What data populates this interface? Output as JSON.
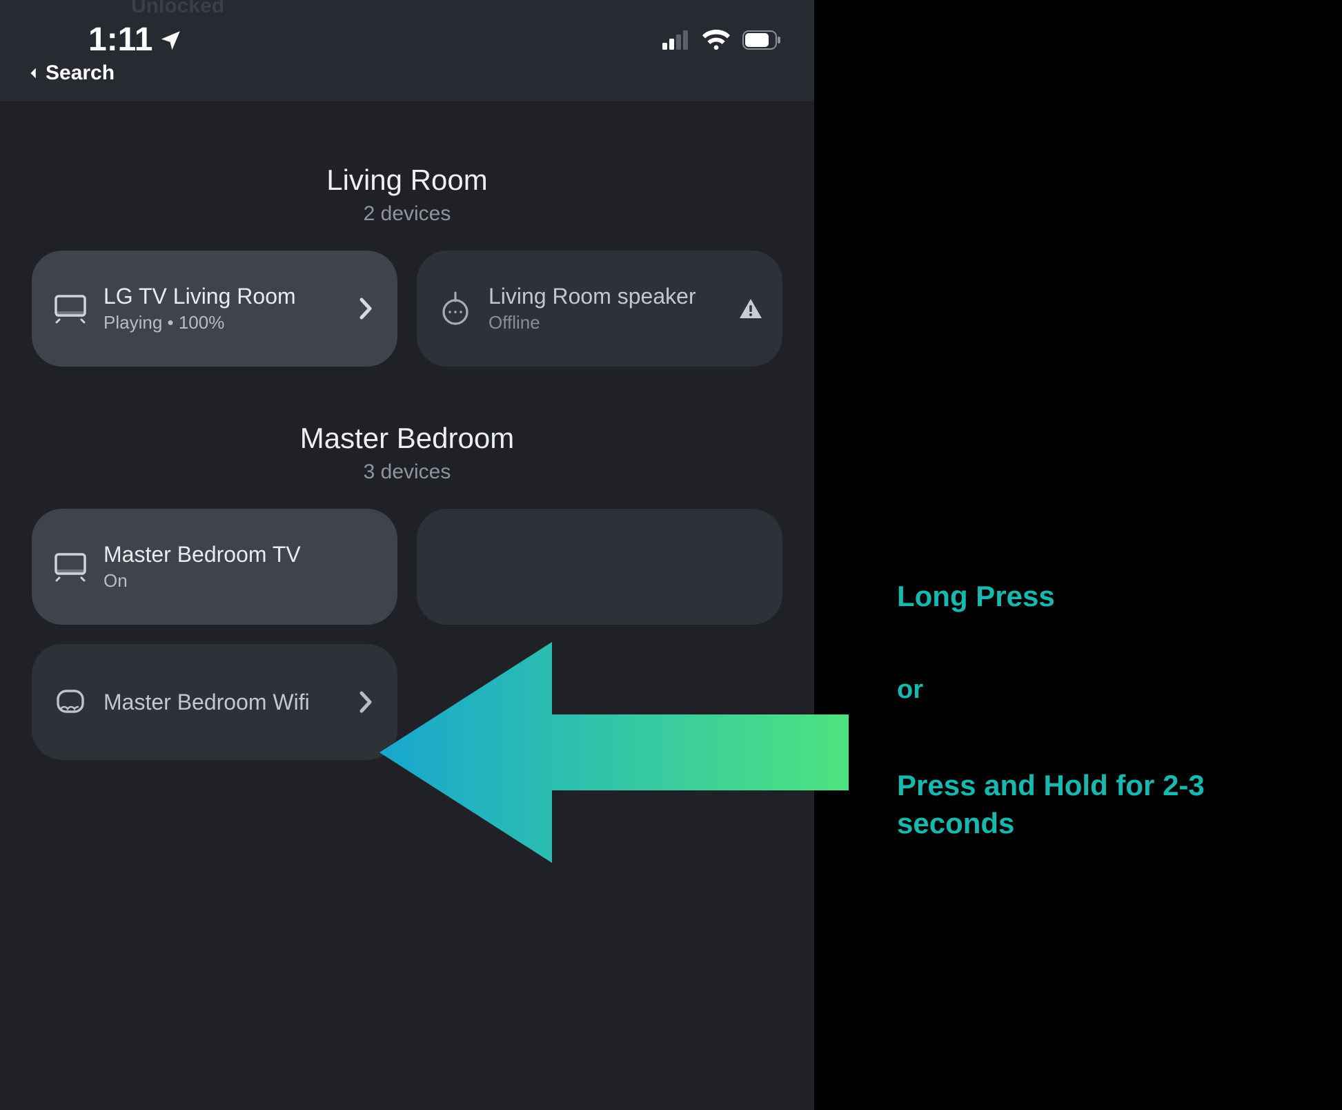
{
  "statusbar": {
    "time": "1:11",
    "back_label": "Search",
    "unlocked_ghost": "Unlocked"
  },
  "rooms": [
    {
      "title": "Living Room",
      "sub": "2 devices",
      "cards": [
        {
          "title": "LG TV Living Room",
          "sub": "Playing • 100%"
        },
        {
          "title": "Living Room speaker",
          "sub": "Offline"
        }
      ]
    },
    {
      "title": "Master Bedroom",
      "sub": "3 devices",
      "cards": [
        {
          "title": "Master Bedroom TV",
          "sub": "On"
        },
        {
          "title": "",
          "sub": ""
        },
        {
          "title": "Master Bedroom Wifi",
          "sub": ""
        }
      ]
    }
  ],
  "annotation": {
    "line1": "Long Press",
    "line2": "or",
    "line3": "Press and Hold for 2-3 seconds"
  },
  "colors": {
    "accent": "#15b9b0",
    "arrow_grad_from": "#17a7cf",
    "arrow_grad_to": "#4fe37f"
  }
}
